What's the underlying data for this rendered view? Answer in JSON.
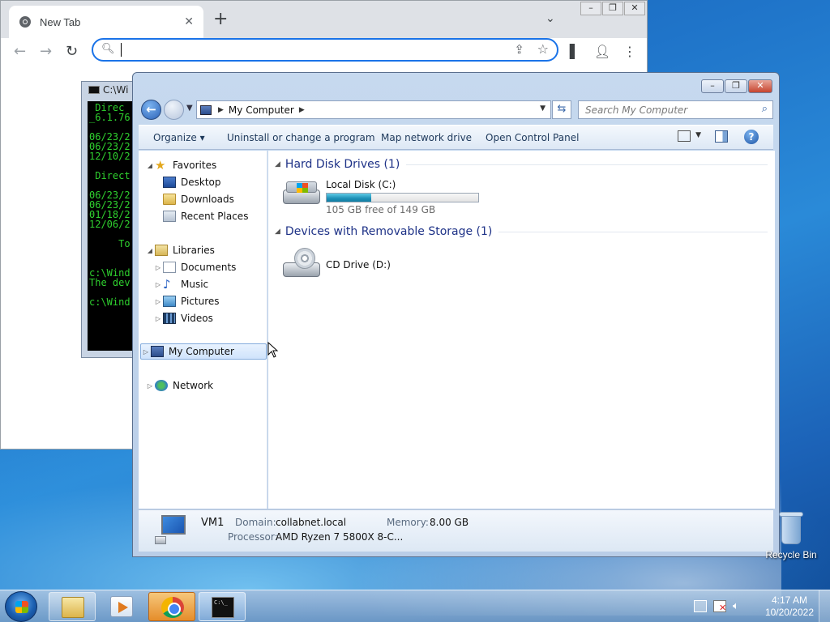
{
  "colors": {
    "accent": "#1a73e8",
    "explorer_header": "#1e3287",
    "usage_fill": "#1d8fb6",
    "cmd_text": "#2fd12f"
  },
  "chrome": {
    "tab_title": "New Tab",
    "tab_close": "✕",
    "new_tab": "+",
    "tab_search": "⌄",
    "win_min": "–",
    "win_max": "❐",
    "win_close": "✕",
    "back": "←",
    "forward": "→",
    "reload": "↻",
    "omnibox_value": "",
    "search_glyph": "🔍︎",
    "share": "⇪",
    "star": "☆",
    "side_panel": "▌",
    "profile": "👤︎",
    "menu": "⋮"
  },
  "cmd": {
    "title": "C:\\Wi",
    "lines": " Direc\n_6.1.76\n\n06/23/2\n06/23/2\n12/10/2\n\n Direct\n\n06/23/2\n06/23/2\n01/18/2\n12/06/2\n\n     To\n\n\nc:\\Wind\nThe dev\n\nc:\\Wind"
  },
  "explorer": {
    "win_min": "–",
    "win_max": "❐",
    "win_close": "✕",
    "back_glyph": "←",
    "address": "My Computer",
    "address_sep": "▶",
    "refresh_glyph": "⇆",
    "search_placeholder": "Search My Computer",
    "search_glyph": "⌕",
    "toolbar": {
      "organize": "Organize ▾",
      "uninstall": "Uninstall or change a program",
      "map_drive": "Map network drive",
      "control_panel": "Open Control Panel",
      "view_caret": "▼",
      "help": "?"
    },
    "nav": {
      "favorites": "Favorites",
      "desktop": "Desktop",
      "downloads": "Downloads",
      "recent": "Recent Places",
      "libraries": "Libraries",
      "documents": "Documents",
      "music": "Music",
      "pictures": "Pictures",
      "videos": "Videos",
      "my_computer": "My Computer",
      "network": "Network",
      "tri_open": "◢",
      "tri_closed": "▷",
      "star": "★",
      "note": "♪"
    },
    "groups": {
      "hdd_header": "Hard Disk Drives (1)",
      "removable_header": "Devices with Removable Storage (1)",
      "tri": "◢"
    },
    "drives": {
      "c_label": "Local Disk (C:)",
      "c_free": "105 GB free of 149 GB",
      "c_used_fraction": 0.295,
      "d_label": "CD Drive (D:)"
    },
    "details": {
      "name": "VM1",
      "domain_label": "Domain:",
      "domain_value": "collabnet.local",
      "memory_label": "Memory:",
      "memory_value": "8.00 GB",
      "processor_label": "Processor:",
      "processor_value": "AMD Ryzen 7 5800X 8-C..."
    }
  },
  "desktop": {
    "recycle_bin": "Recycle Bin"
  },
  "taskbar": {
    "time": "4:17 AM",
    "date": "10/20/2022"
  }
}
